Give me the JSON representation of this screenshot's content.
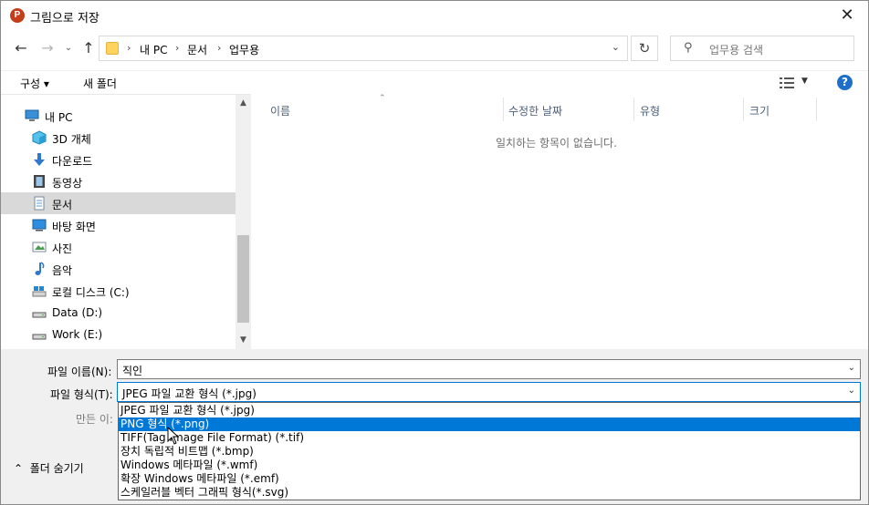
{
  "window": {
    "title": "그림으로 저장",
    "app_icon_letter": "P",
    "close_glyph": "✕"
  },
  "address": {
    "crumbs": [
      "내 PC",
      "문서",
      "업무용"
    ],
    "separator": "›",
    "search_placeholder": "업무용 검색"
  },
  "toolbar": {
    "organize_label": "구성 ▾",
    "new_folder_label": "새 폴더",
    "help_glyph": "?"
  },
  "nav": {
    "items": [
      {
        "label": "내 PC",
        "icon": "pc-icon"
      },
      {
        "label": "3D 개체",
        "icon": "cube-icon"
      },
      {
        "label": "다운로드",
        "icon": "download-icon"
      },
      {
        "label": "동영상",
        "icon": "video-icon"
      },
      {
        "label": "문서",
        "icon": "document-icon",
        "selected": true
      },
      {
        "label": "바탕 화면",
        "icon": "desktop-icon"
      },
      {
        "label": "사진",
        "icon": "pictures-icon"
      },
      {
        "label": "음악",
        "icon": "music-icon"
      },
      {
        "label": "로컬 디스크 (C:)",
        "icon": "drive-icon"
      },
      {
        "label": "Data (D:)",
        "icon": "drive-icon"
      },
      {
        "label": "Work (E:)",
        "icon": "drive-icon"
      }
    ]
  },
  "filelist": {
    "columns": [
      "이름",
      "수정한 날짜",
      "유형",
      "크기"
    ],
    "empty_message": "일치하는 항목이 없습니다."
  },
  "form": {
    "filename_label": "파일 이름(N):",
    "filename_value": "직인",
    "filetype_label": "파일 형식(T):",
    "filetype_value": "JPEG 파일 교환 형식 (*.jpg)",
    "authors_label": "만든 이:"
  },
  "filetype_options": [
    {
      "label": "JPEG 파일 교환 형식 (*.jpg)",
      "selected": false
    },
    {
      "label": "PNG 형식 (*.png)",
      "selected": true
    },
    {
      "label": "TIFF(Tag Image File Format) (*.tif)",
      "selected": false
    },
    {
      "label": "장치 독립적 비트맵 (*.bmp)",
      "selected": false
    },
    {
      "label": "Windows 메타파일 (*.wmf)",
      "selected": false
    },
    {
      "label": "확장 Windows 메타파일 (*.emf)",
      "selected": false
    },
    {
      "label": "스케일러블 벡터 그래픽 형식(*.svg)",
      "selected": false
    }
  ],
  "footer": {
    "hide_folders_label": "폴더 숨기기"
  },
  "colors": {
    "accent": "#0078d7",
    "selection_gray": "#d9d9d9",
    "panel_bg": "#f0f0f0"
  }
}
